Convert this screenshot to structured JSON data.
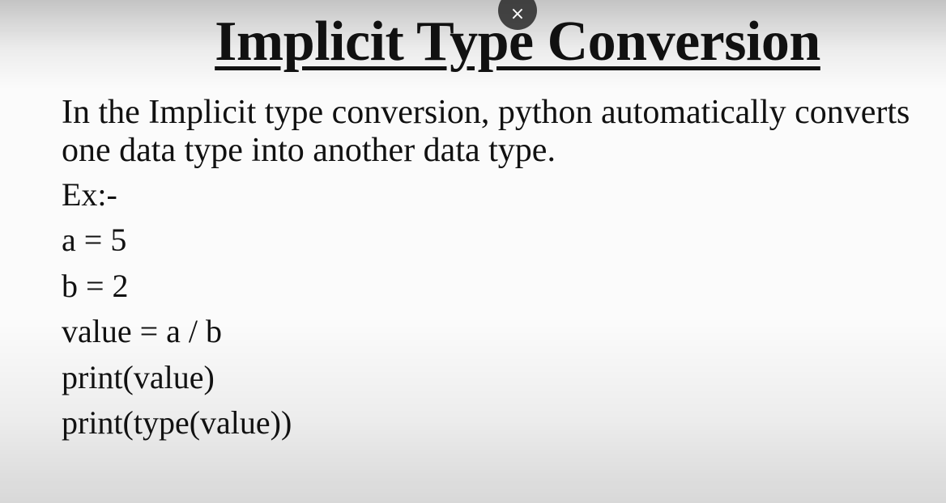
{
  "overlay": {
    "close_symbol": "×",
    "close_icon": "close-icon"
  },
  "slide": {
    "title": "Implicit Type Conversion",
    "description_line1": "In the Implicit type conversion, python automatically converts",
    "description_line2": "one data type into another data type.",
    "example_label": "Ex:-",
    "code_lines": [
      "a = 5",
      "b = 2",
      "value = a / b",
      "print(value)",
      "print(type(value))"
    ]
  }
}
